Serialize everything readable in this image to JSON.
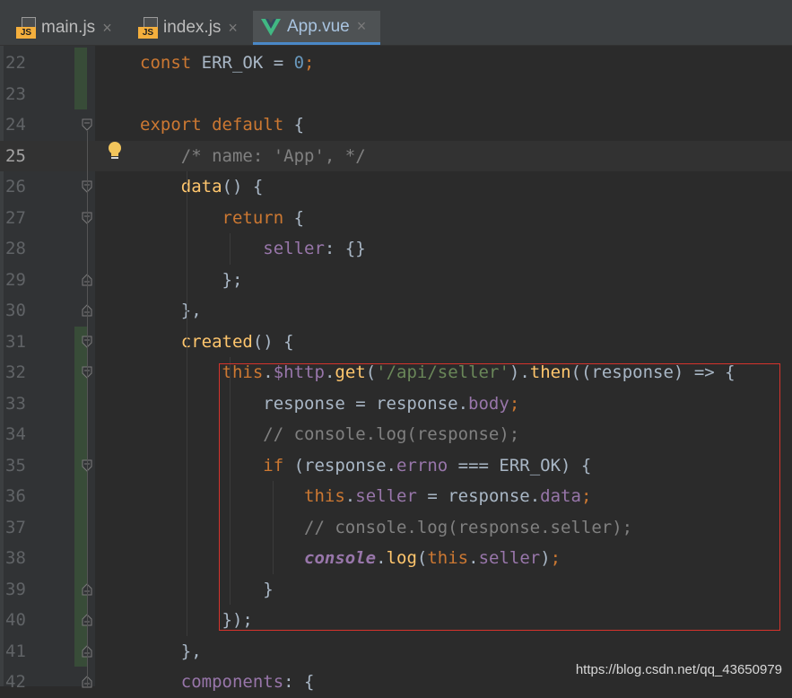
{
  "tabs": [
    {
      "label": "main.js",
      "icon": "js-file-icon",
      "active": false,
      "badge": "JS"
    },
    {
      "label": "index.js",
      "icon": "js-file-icon",
      "active": false,
      "badge": "JS"
    },
    {
      "label": "App.vue",
      "icon": "vue-file-icon",
      "active": true
    }
  ],
  "close_glyph": "×",
  "current_line": 25,
  "lines": [
    {
      "n": "22",
      "tokens": [
        [
          "const ",
          "kw"
        ],
        [
          "ERR_OK = ",
          ""
        ],
        [
          "0",
          "num"
        ],
        [
          ";",
          "kw"
        ]
      ]
    },
    {
      "n": "23",
      "tokens": []
    },
    {
      "n": "24",
      "tokens": [
        [
          "export default ",
          "kw"
        ],
        [
          "{",
          ""
        ]
      ]
    },
    {
      "n": "25",
      "tokens": [
        [
          "    /* name: 'App', */",
          "cm"
        ]
      ]
    },
    {
      "n": "26",
      "tokens": [
        [
          "    ",
          ""
        ],
        [
          "data",
          "fn"
        ],
        [
          "() {",
          ""
        ]
      ]
    },
    {
      "n": "27",
      "tokens": [
        [
          "        ",
          ""
        ],
        [
          "return ",
          "kw"
        ],
        [
          "{",
          ""
        ]
      ]
    },
    {
      "n": "28",
      "tokens": [
        [
          "            ",
          ""
        ],
        [
          "seller",
          "prop"
        ],
        [
          ": {}",
          ""
        ]
      ]
    },
    {
      "n": "29",
      "tokens": [
        [
          "        };",
          ""
        ]
      ]
    },
    {
      "n": "30",
      "tokens": [
        [
          "    },",
          ""
        ]
      ]
    },
    {
      "n": "31",
      "tokens": [
        [
          "    ",
          ""
        ],
        [
          "created",
          "fn"
        ],
        [
          "() {",
          ""
        ]
      ]
    },
    {
      "n": "32",
      "tokens": [
        [
          "        ",
          ""
        ],
        [
          "this",
          "kw"
        ],
        [
          ".",
          ""
        ],
        [
          "$http",
          "prop"
        ],
        [
          ".",
          ""
        ],
        [
          "get",
          "fn"
        ],
        [
          "(",
          ""
        ],
        [
          "'/api/seller'",
          "str"
        ],
        [
          ").",
          ""
        ],
        [
          "then",
          "fn"
        ],
        [
          "((response) => {",
          ""
        ]
      ]
    },
    {
      "n": "33",
      "tokens": [
        [
          "            response = response.",
          ""
        ],
        [
          "body",
          "prop"
        ],
        [
          ";",
          "kw"
        ]
      ]
    },
    {
      "n": "34",
      "tokens": [
        [
          "            // console.log(response);",
          "cm"
        ]
      ]
    },
    {
      "n": "35",
      "tokens": [
        [
          "            ",
          ""
        ],
        [
          "if ",
          "kw"
        ],
        [
          "(response.",
          ""
        ],
        [
          "errno",
          "prop"
        ],
        [
          " === ERR_OK) {",
          ""
        ]
      ]
    },
    {
      "n": "36",
      "tokens": [
        [
          "                ",
          ""
        ],
        [
          "this",
          "kw"
        ],
        [
          ".",
          ""
        ],
        [
          "seller",
          "prop"
        ],
        [
          " = response.",
          ""
        ],
        [
          "data",
          "prop"
        ],
        [
          ";",
          "kw"
        ]
      ]
    },
    {
      "n": "37",
      "tokens": [
        [
          "                // console.log(response.seller);",
          "cm"
        ]
      ]
    },
    {
      "n": "38",
      "tokens": [
        [
          "                ",
          ""
        ],
        [
          "console",
          "ital"
        ],
        [
          ".",
          ""
        ],
        [
          "log",
          "fn"
        ],
        [
          "(",
          ""
        ],
        [
          "this",
          "kw"
        ],
        [
          ".",
          ""
        ],
        [
          "seller",
          "prop"
        ],
        [
          ")",
          ""
        ],
        [
          ";",
          "kw"
        ]
      ]
    },
    {
      "n": "39",
      "tokens": [
        [
          "            }",
          ""
        ]
      ]
    },
    {
      "n": "40",
      "tokens": [
        [
          "        });",
          ""
        ]
      ]
    },
    {
      "n": "41",
      "tokens": [
        [
          "    },",
          ""
        ]
      ]
    },
    {
      "n": "42",
      "tokens": [
        [
          "    ",
          ""
        ],
        [
          "components",
          "prop"
        ],
        [
          ": {",
          ""
        ]
      ]
    }
  ],
  "watermark": "https://blog.csdn.net/qq_43650979",
  "colors": {
    "background": "#2b2b2b",
    "keyword": "#cc7832",
    "string": "#6a8759",
    "number": "#6897bb",
    "comment": "#808080",
    "property": "#9876aa",
    "function": "#ffc66d",
    "highlight_box": "#d6332c"
  }
}
